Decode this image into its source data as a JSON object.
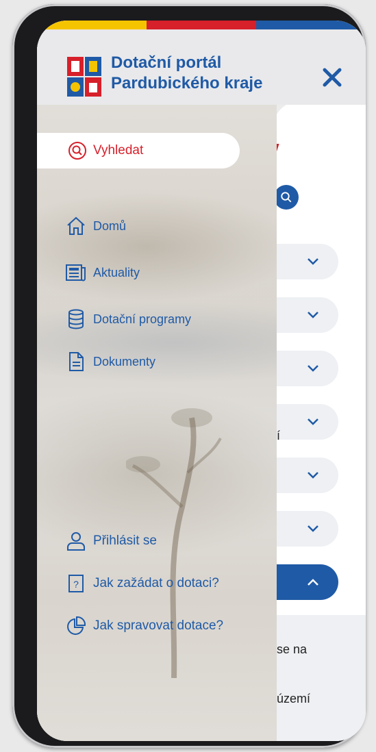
{
  "app": {
    "title_line1": "Dotační portál",
    "title_line2": "Pardubického kraje"
  },
  "colors": {
    "brand_blue": "#1f5aa6",
    "brand_red": "#d6202a",
    "brand_yellow": "#f5c400"
  },
  "header": {
    "logo": "pardubice-region-coat-of-arms",
    "close_icon": "close-icon"
  },
  "drawer": {
    "search_label": "Vyhledat",
    "nav": [
      {
        "label": "Domů",
        "icon": "home-icon"
      },
      {
        "label": "Aktuality",
        "icon": "newspaper-icon"
      },
      {
        "label": "Dotační programy",
        "icon": "database-icon"
      },
      {
        "label": "Dokumenty",
        "icon": "document-icon"
      }
    ],
    "bottom": [
      {
        "label": "Přihlásit se",
        "icon": "user-icon"
      },
      {
        "label": "Jak zažádat o dotaci?",
        "icon": "question-box-icon"
      },
      {
        "label": "Jak spravovat dotace?",
        "icon": "pie-chart-icon"
      }
    ]
  },
  "background_page": {
    "fragments": [
      "í",
      "se na",
      "území"
    ]
  }
}
